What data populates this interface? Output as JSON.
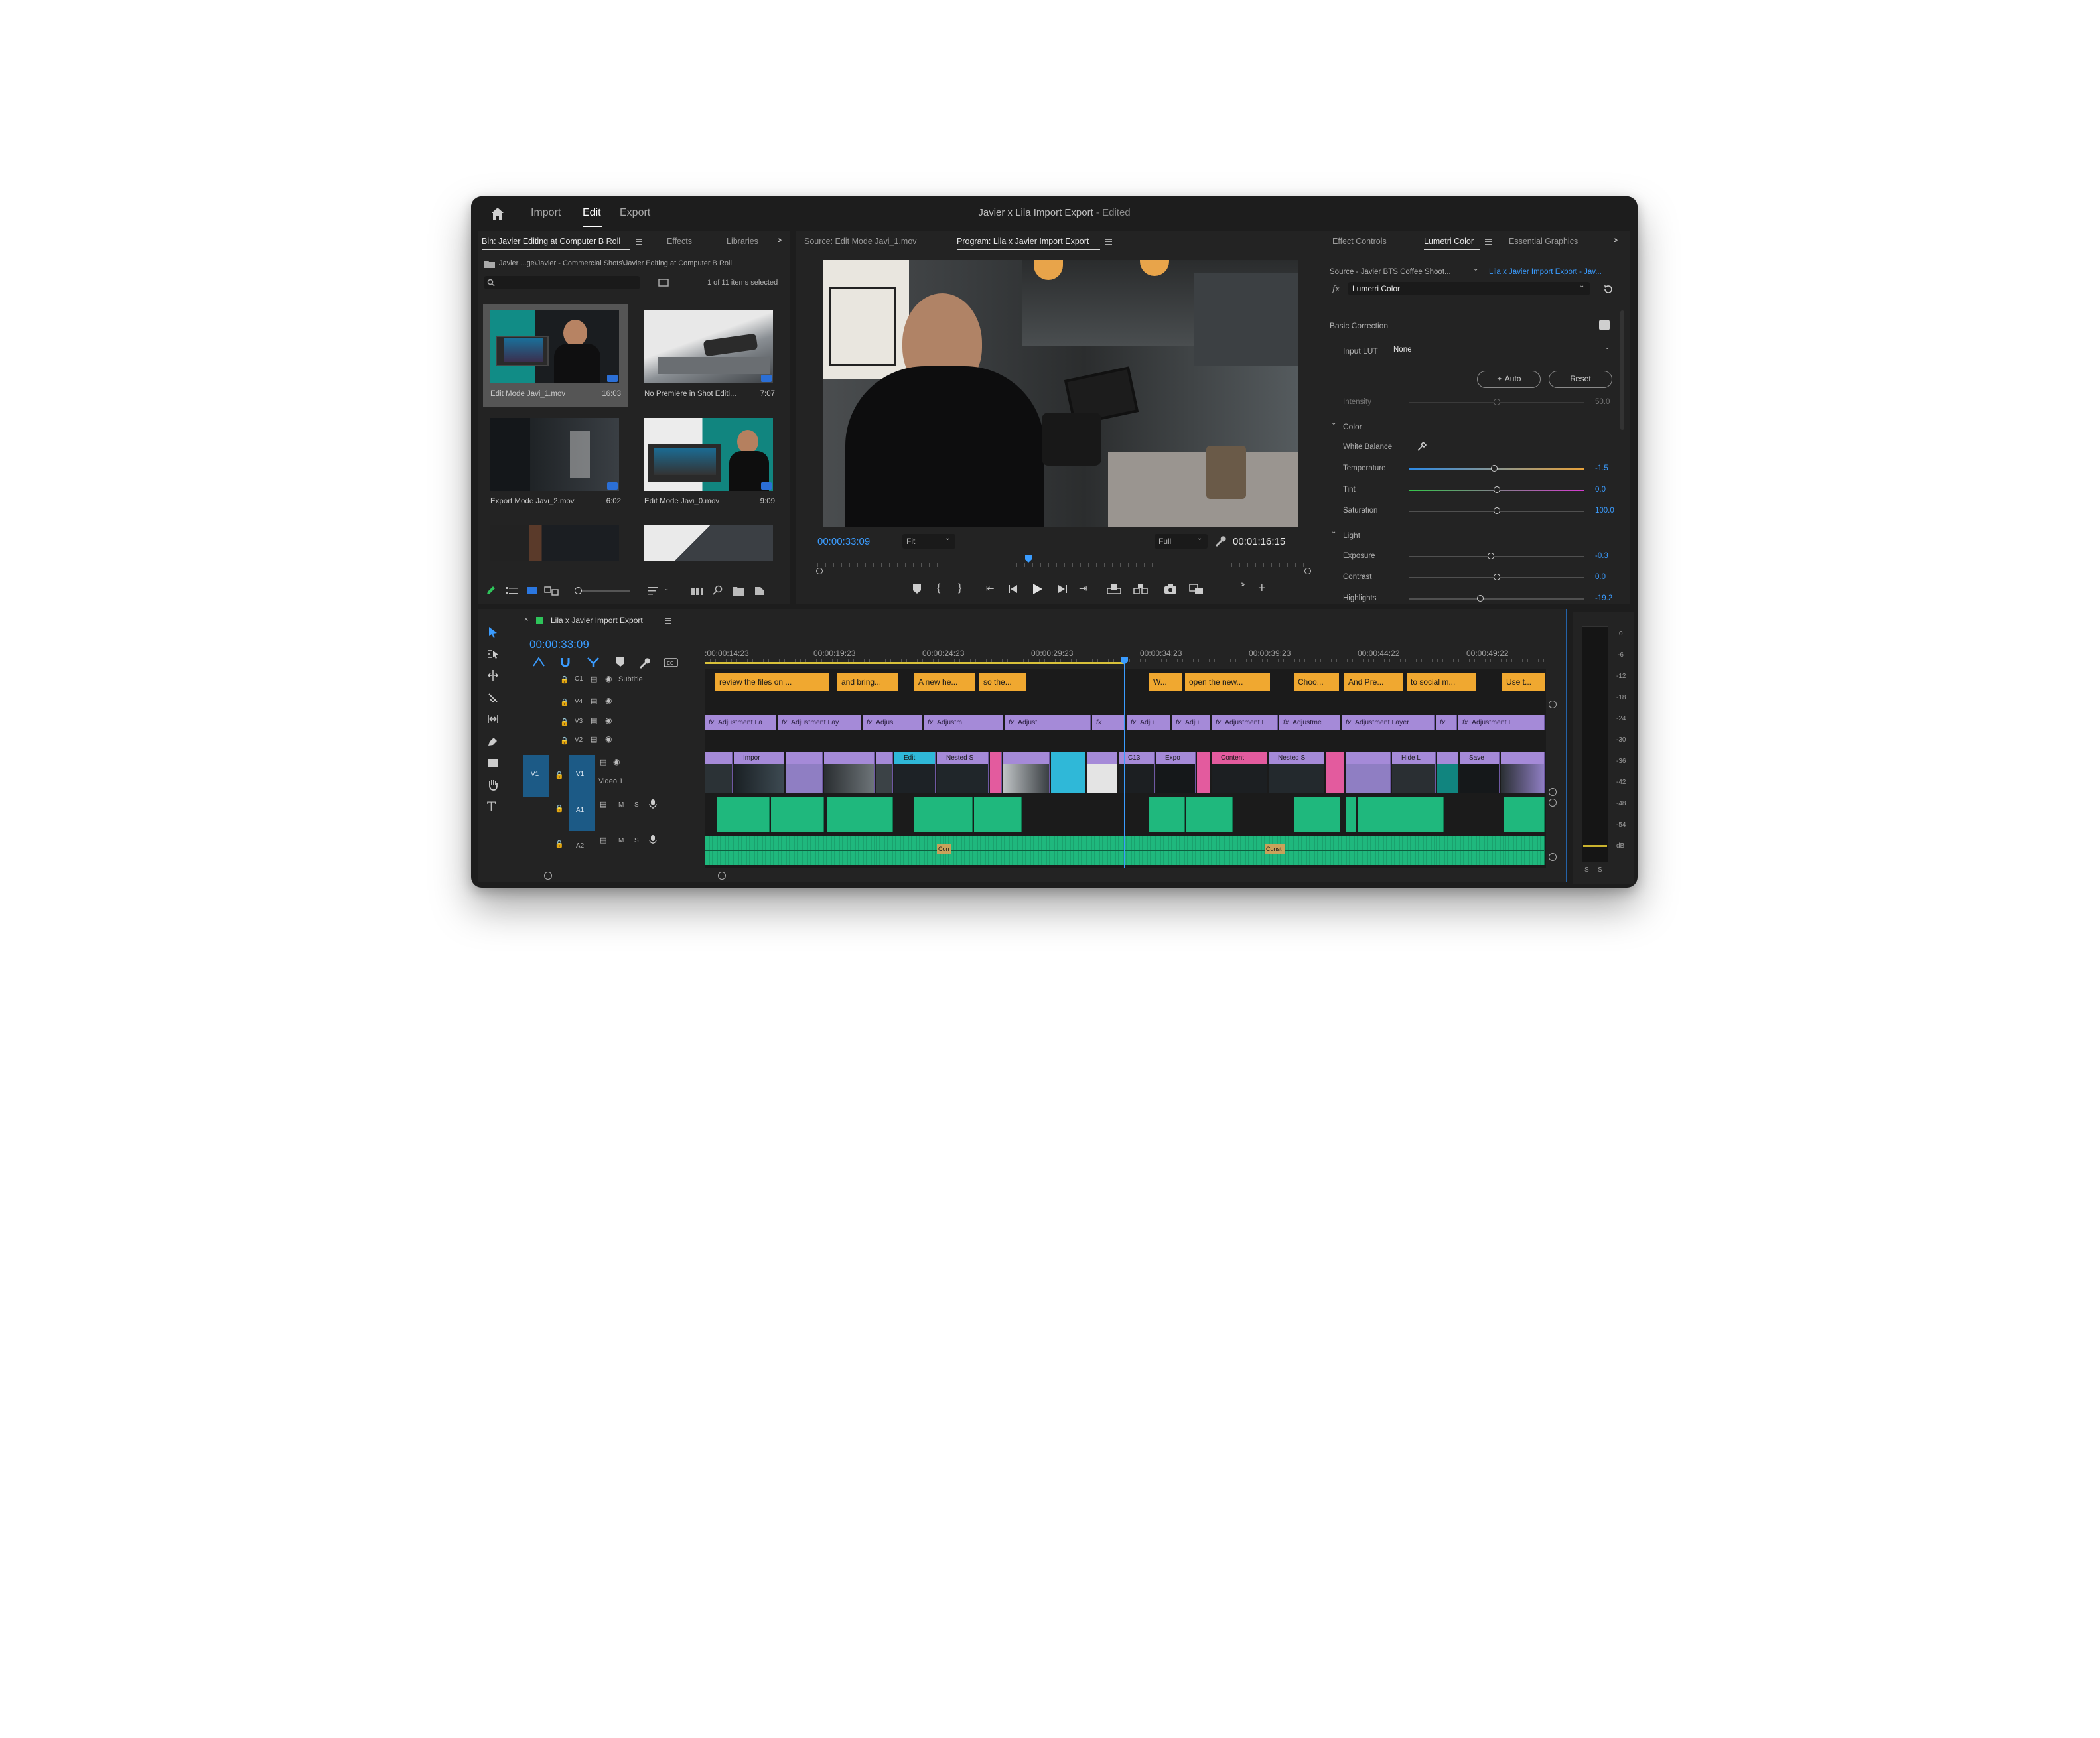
{
  "window": {
    "nav": [
      "Import",
      "Edit",
      "Export"
    ],
    "title": "Javier x Lila Import Export",
    "title_suffix": " - Edited"
  },
  "project": {
    "tabs": [
      "Bin: Javier Editing at Computer B Roll",
      "Effects",
      "Libraries"
    ],
    "path": "Javier ...ge\\Javier - Commercial Shots\\Javier Editing at Computer B Roll",
    "selection": "1 of 11 items selected",
    "clips": [
      {
        "name": "Edit Mode Javi_1.mov",
        "duration": "16:03"
      },
      {
        "name": "No Premiere in Shot Editi...",
        "duration": "7:07"
      },
      {
        "name": "Export Mode Javi_2.mov",
        "duration": "6:02"
      },
      {
        "name": "Edit Mode Javi_0.mov",
        "duration": "9:09"
      }
    ]
  },
  "monitor": {
    "source_tab": "Source: Edit Mode Javi_1.mov",
    "program_tab": "Program: Lila x Javier Import Export",
    "timecode": "00:00:33:09",
    "fit": "Fit",
    "quality": "Full",
    "duration": "00:01:16:15"
  },
  "lumetri": {
    "tabs": [
      "Effect Controls",
      "Lumetri Color",
      "Essential Graphics"
    ],
    "source": "Source - Javier BTS Coffee Shoot...",
    "target": "Lila x Javier Import Export - Jav...",
    "effect": "Lumetri Color",
    "basic_correction": "Basic Correction",
    "input_lut_label": "Input LUT",
    "input_lut_value": "None",
    "auto": "Auto",
    "reset": "Reset",
    "intensity": {
      "label": "Intensity",
      "value": "50.0"
    },
    "color_section": "Color",
    "white_balance": "White Balance",
    "temperature": {
      "label": "Temperature",
      "value": "-1.5"
    },
    "tint": {
      "label": "Tint",
      "value": "0.0"
    },
    "saturation": {
      "label": "Saturation",
      "value": "100.0"
    },
    "light_section": "Light",
    "exposure": {
      "label": "Exposure",
      "value": "-0.3"
    },
    "contrast": {
      "label": "Contrast",
      "value": "0.0"
    },
    "highlights": {
      "label": "Highlights",
      "value": "-19.2"
    }
  },
  "timeline": {
    "sequence": "Lila x Javier Import Export",
    "timecode": "00:00:33:09",
    "ruler": [
      ":00:00:14:23",
      "00:00:19:23",
      "00:00:24:23",
      "00:00:29:23",
      "00:00:34:23",
      "00:00:39:23",
      "00:00:44:22",
      "00:00:49:22"
    ],
    "tracks": {
      "c1": "C1",
      "subtitle": "Subtitle",
      "v4": "V4",
      "v3": "V3",
      "v2": "V2",
      "v1": "V1",
      "video1": "Video 1",
      "a1": "A1",
      "a2": "A2",
      "m": "M",
      "s": "S"
    },
    "subtitles": [
      "review the files on ...",
      "and bring...",
      "A new he...",
      "so the...",
      "W...",
      "open the new...",
      "Choo...",
      "And Pre...",
      "to social m...",
      "Use t..."
    ],
    "adjustments": [
      "Adjustment La",
      "Adjustment Lay",
      "Adjus",
      "Adjustm",
      "Adjust",
      "Adju",
      "Adju",
      "Adjustment L",
      "Adjustme",
      "Adjustment Layer",
      "Adjustment L"
    ],
    "video_headers": [
      "Impor",
      "Edit",
      "Nested S",
      "C13",
      "Expo",
      "Content",
      "Nested S",
      "Hide L",
      "Save"
    ],
    "audio_tags": [
      "Con",
      "Const"
    ]
  },
  "meter": {
    "scale": [
      "0",
      "-6",
      "-12",
      "-18",
      "-24",
      "-30",
      "-36",
      "-42",
      "-48",
      "-54",
      "dB"
    ],
    "solo": [
      "S",
      "S"
    ]
  }
}
